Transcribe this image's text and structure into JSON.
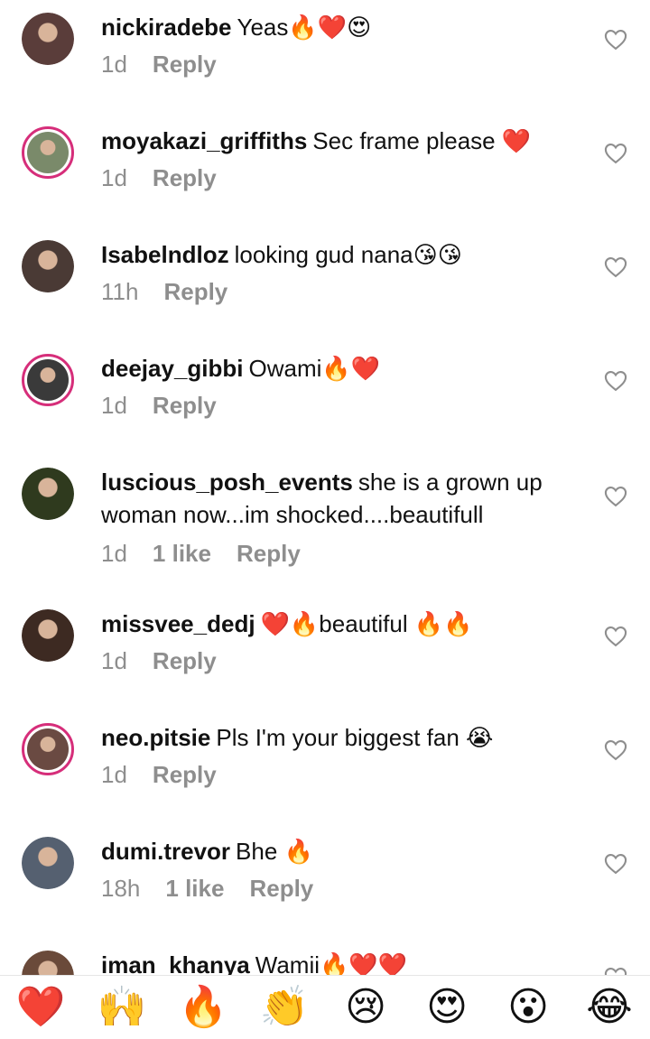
{
  "comments": [
    {
      "username": "nickiradebe",
      "text": "Yeas🔥❤️😍",
      "time": "1d",
      "likes": "",
      "reply": "Reply",
      "ring": false,
      "avatar_color": "#5a3d3a"
    },
    {
      "username": "moyakazi_griffiths",
      "text": "Sec frame please ❤️",
      "time": "1d",
      "likes": "",
      "reply": "Reply",
      "ring": true,
      "avatar_color": "#7a8a6a"
    },
    {
      "username": "Isabelndloz",
      "text": "looking gud nana😘😘",
      "time": "11h",
      "likes": "",
      "reply": "Reply",
      "ring": false,
      "avatar_color": "#4a3a35"
    },
    {
      "username": "deejay_gibbi",
      "text": "Owami🔥❤️",
      "time": "1d",
      "likes": "",
      "reply": "Reply",
      "ring": true,
      "avatar_color": "#3a3a3a"
    },
    {
      "username": "luscious_posh_events",
      "text": "she is a grown up woman now...im shocked....beautifull",
      "time": "1d",
      "likes": "1 like",
      "reply": "Reply",
      "ring": false,
      "avatar_color": "#2f3a1e"
    },
    {
      "username": "missvee_dedj",
      "text": "❤️🔥beautiful 🔥🔥",
      "time": "1d",
      "likes": "",
      "reply": "Reply",
      "ring": false,
      "avatar_color": "#3d2a22"
    },
    {
      "username": "neo.pitsie",
      "text": "Pls I'm your biggest fan 😭",
      "time": "1d",
      "likes": "",
      "reply": "Reply",
      "ring": true,
      "avatar_color": "#6a4a42"
    },
    {
      "username": "dumi.trevor",
      "text": "Bhe 🔥",
      "time": "18h",
      "likes": "1 like",
      "reply": "Reply",
      "ring": false,
      "avatar_color": "#556070"
    },
    {
      "username": "iman_khanya",
      "text": "Wamii🔥❤️❤️",
      "time": "",
      "likes": "",
      "reply": "",
      "ring": false,
      "avatar_color": "#6a4a3a"
    }
  ],
  "reactions": [
    "❤️",
    "🙌",
    "🔥",
    "👏",
    "😢",
    "😍",
    "😮",
    "😂"
  ],
  "colors": {
    "ring": "#d62e7a",
    "meta": "#8e8e8e",
    "heart_outline": "#8e8e8e"
  }
}
